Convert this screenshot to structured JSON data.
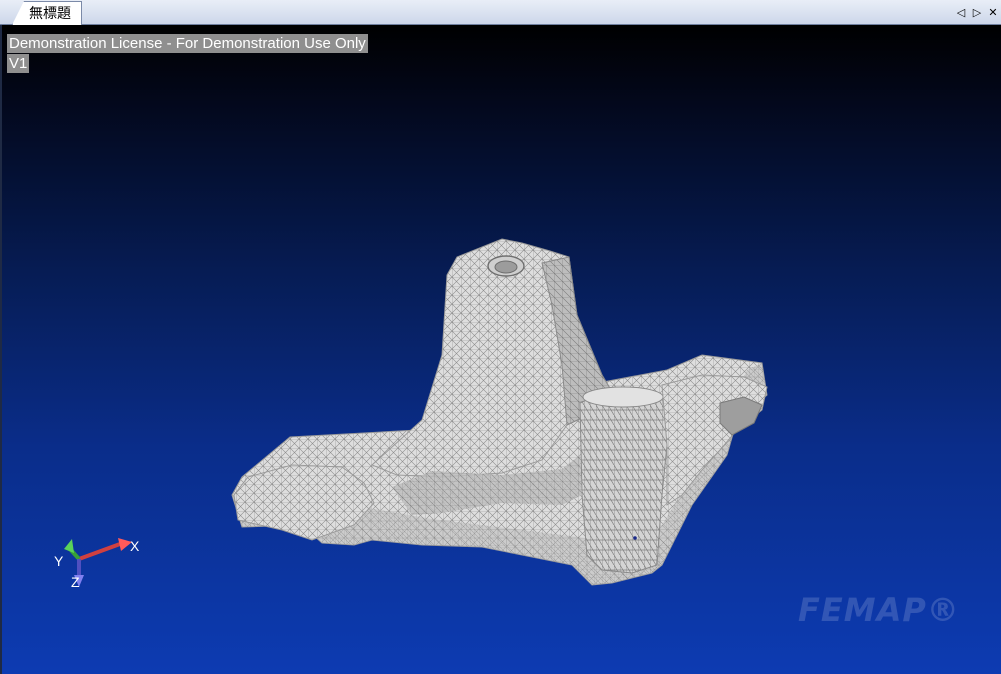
{
  "tab": {
    "title": "無標題"
  },
  "tab_nav": {
    "prev": "◁",
    "next": "▷",
    "close": "✕"
  },
  "viewport": {
    "license_text": "Demonstration License - For Demonstration Use Only",
    "view_label": "V1",
    "triad": {
      "x": "X",
      "y": "Y",
      "z": "Z"
    },
    "watermark": "FEMAP®"
  },
  "colors": {
    "bg_top": "#000000",
    "bg_bottom": "#0d3bb2",
    "mesh_fill": "#dcdcdc",
    "mesh_line": "#8a8a8a",
    "axis_x": "#e05050",
    "axis_y": "#4caf50",
    "axis_z": "#6a6ad8"
  }
}
